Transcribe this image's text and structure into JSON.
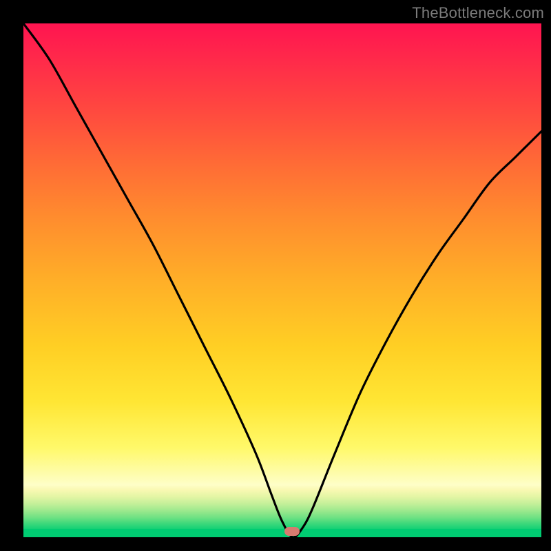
{
  "watermark": "TheBottleneck.com",
  "marker": {
    "x_frac": 0.518,
    "y_frac": 0.988
  },
  "chart_data": {
    "type": "line",
    "title": "",
    "xlabel": "",
    "ylabel": "",
    "xlim": [
      0,
      1
    ],
    "ylim": [
      0,
      1
    ],
    "series": [
      {
        "name": "bottleneck-curve",
        "x": [
          0.0,
          0.05,
          0.1,
          0.15,
          0.2,
          0.25,
          0.3,
          0.35,
          0.4,
          0.45,
          0.48,
          0.5,
          0.52,
          0.54,
          0.56,
          0.6,
          0.65,
          0.7,
          0.75,
          0.8,
          0.85,
          0.9,
          0.95,
          1.0
        ],
        "y": [
          1.0,
          0.93,
          0.84,
          0.75,
          0.66,
          0.57,
          0.47,
          0.37,
          0.27,
          0.16,
          0.08,
          0.03,
          0.0,
          0.02,
          0.06,
          0.16,
          0.28,
          0.38,
          0.47,
          0.55,
          0.62,
          0.69,
          0.74,
          0.79
        ]
      }
    ],
    "annotations": [
      {
        "type": "marker",
        "x": 0.518,
        "y": 0.012,
        "color": "#d77a6f",
        "shape": "rounded-rect"
      }
    ],
    "background": {
      "gradient_top": "#ff1450",
      "gradient_mid": "#ffe634",
      "gradient_bottom": "#00cc72"
    }
  }
}
